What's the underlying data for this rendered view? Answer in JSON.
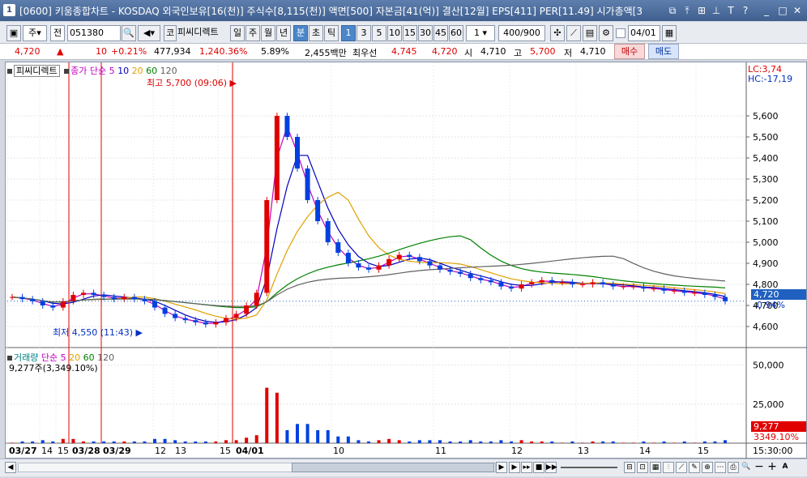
{
  "window": {
    "number": "1",
    "title": "[0600] 키움종합차트 - KOSDAQ 외국인보유[16(천)] 주식수[8,115(천)] 액면[500] 자본금[41(억)] 결산[12월] EPS[411] PER[11.49] 시가총액[3"
  },
  "toolbar": {
    "period_unit": "주",
    "price_type": "전",
    "code": "051380",
    "name_tag": "코",
    "stock_name": "피씨디렉트",
    "periods": [
      "일",
      "주",
      "월",
      "년",
      "분",
      "초",
      "틱"
    ],
    "selected_period": "분",
    "intervals": [
      "1",
      "3",
      "5",
      "10",
      "15",
      "30",
      "45",
      "60"
    ],
    "selected_interval": "1",
    "interval_input": "1",
    "count": "400",
    "count_total": "/900",
    "date_input": "04/01"
  },
  "quote": {
    "price": "4,720",
    "change": "10",
    "change_pct": "+0.21%",
    "volume": "477,934",
    "volume_ratio": "1,240.36%",
    "turnover_pct": "5.89%",
    "amount": "2,455백만",
    "bid_label": "최우선",
    "best_ask": "4,745",
    "best_bid": "4,720",
    "open_label": "시",
    "open": "4,710",
    "high_label": "고",
    "high": "5,700",
    "low_label": "저",
    "low": "4,710",
    "buy_button": "매수",
    "sell_button": "매도"
  },
  "price_legend": {
    "name": "피씨디렉트",
    "close_label": "종가",
    "ma_label": "단순",
    "ma_periods": [
      "5",
      "10",
      "20",
      "60",
      "120"
    ],
    "ma_colors": [
      "#c000c0",
      "#0000c0",
      "#e0a000",
      "#008000",
      "#606060"
    ]
  },
  "volume_legend": {
    "name": "거래량",
    "ma_label": "단순",
    "ma_periods": [
      "5",
      "20",
      "60",
      "120"
    ],
    "current": "9,277주(3,349.10%)"
  },
  "annotations": {
    "lc": "LC:3,74",
    "hc": "HC:-17,19",
    "high_marker": "최고 5,700 (09:06)",
    "low_marker": "최저 4,550 (11:43)",
    "current_price": "4,720",
    "current_pct": "-0.94%",
    "current_volume": "9,277",
    "current_volume_pct": "3349.10%"
  },
  "chart_data": {
    "type": "candlestick",
    "price_axis": {
      "ticks": [
        "5,600",
        "5,500",
        "5,400",
        "5,300",
        "5,200",
        "5,100",
        "5,000",
        "4,900",
        "4,800",
        "4,700",
        "4,600"
      ],
      "ylim": [
        4500,
        5800
      ]
    },
    "volume_axis": {
      "ticks": [
        "50,000",
        "25,000"
      ],
      "ylim": [
        0,
        55000
      ]
    },
    "time_labels": [
      "03/27",
      "14",
      "15",
      "03/28",
      "03/29",
      "12",
      "13",
      "15",
      "04/01",
      "10",
      "11",
      "12",
      "13",
      "14",
      "15",
      "15:30:00"
    ],
    "close_series": [
      4740,
      4730,
      4720,
      4700,
      4690,
      4720,
      4750,
      4760,
      4750,
      4740,
      4730,
      4740,
      4730,
      4720,
      4690,
      4660,
      4640,
      4630,
      4620,
      4610,
      4620,
      4640,
      4660,
      4700,
      4760,
      5200,
      5600,
      5500,
      5350,
      5200,
      5100,
      5000,
      4950,
      4900,
      4880,
      4870,
      4890,
      4920,
      4940,
      4930,
      4910,
      4890,
      4870,
      4860,
      4850,
      4830,
      4820,
      4810,
      4790,
      4780,
      4800,
      4810,
      4820,
      4810,
      4810,
      4800,
      4800,
      4810,
      4800,
      4790,
      4790,
      4790,
      4780,
      4780,
      4770,
      4770,
      4760,
      4760,
      4750,
      4740,
      4720
    ],
    "high": 5700,
    "low": 4550,
    "last_volume": 9277
  }
}
